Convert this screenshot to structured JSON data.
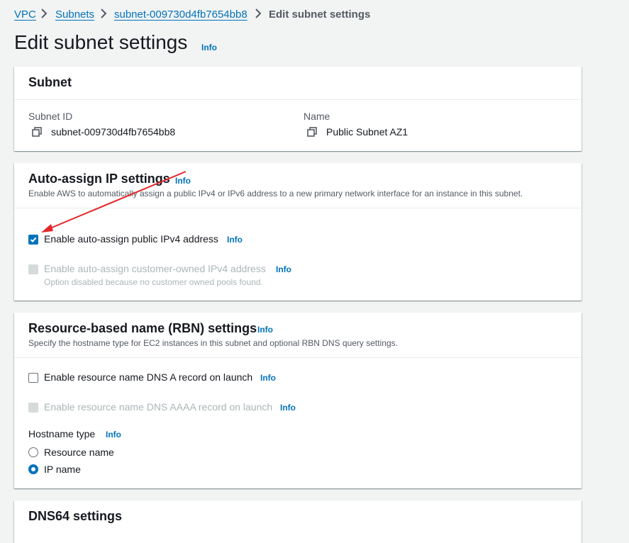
{
  "breadcrumb": {
    "items": [
      "VPC",
      "Subnets",
      "subnet-009730d4fb7654bb8"
    ],
    "current": "Edit subnet settings"
  },
  "page": {
    "title": "Edit subnet settings",
    "info": "Info"
  },
  "subnet_panel": {
    "title": "Subnet",
    "id_label": "Subnet ID",
    "id_value": "subnet-009730d4fb7654bb8",
    "name_label": "Name",
    "name_value": "Public Subnet AZ1"
  },
  "auto_assign_panel": {
    "title": "Auto-assign IP settings",
    "info": "Info",
    "description": "Enable AWS to automatically assign a public IPv4 or IPv6 address to a new primary network interface for an instance in this subnet.",
    "options": [
      {
        "label": "Enable auto-assign public IPv4 address",
        "info": "Info",
        "checked": true,
        "disabled": false
      },
      {
        "label": "Enable auto-assign customer-owned IPv4 address",
        "info": "Info",
        "checked": false,
        "disabled": true,
        "hint": "Option disabled because no customer owned pools found."
      }
    ]
  },
  "rbn_panel": {
    "title": "Resource-based name (RBN) settings",
    "info": "Info",
    "description": "Specify the hostname type for EC2 instances in this subnet and optional RBN DNS query settings.",
    "options": [
      {
        "label": "Enable resource name DNS A record on launch",
        "info": "Info",
        "checked": false,
        "disabled": false
      },
      {
        "label": "Enable resource name DNS AAAA record on launch",
        "info": "Info",
        "checked": false,
        "disabled": true
      }
    ],
    "hostname_type": {
      "label": "Hostname type",
      "info": "Info",
      "choices": [
        "Resource name",
        "IP name"
      ],
      "selected": "IP name"
    }
  },
  "dns64_panel": {
    "title": "DNS64 settings"
  },
  "annotation": {
    "arrow_color": "#e5262a"
  },
  "colors": {
    "link": "#0073bb",
    "background": "#f2f3f3",
    "panel": "#ffffff"
  }
}
